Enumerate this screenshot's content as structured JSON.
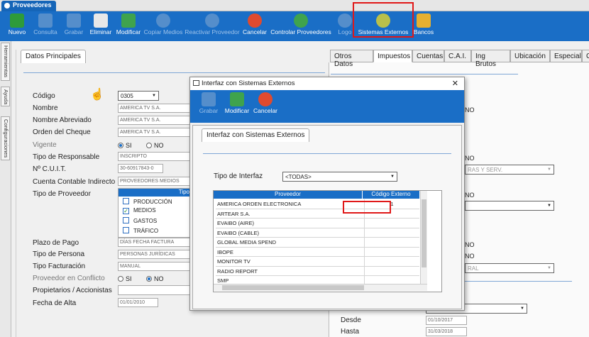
{
  "app": {
    "tab_label": "Proveedores"
  },
  "toolbar": [
    {
      "label": "Nuevo",
      "color": "#2e9b3a",
      "enabled": true
    },
    {
      "label": "Consulta",
      "color": "#9db5d0",
      "enabled": false
    },
    {
      "label": "Grabar",
      "color": "#9db5d0",
      "enabled": false
    },
    {
      "label": "Eliminar",
      "color": "#e8e8e8",
      "enabled": true
    },
    {
      "label": "Modificar",
      "color": "#3fa34d",
      "enabled": true
    },
    {
      "label": "Copiar Medios",
      "color": "#9db5d0",
      "enabled": false
    },
    {
      "label": "Reactivar Proveedor",
      "color": "#9db5d0",
      "enabled": false
    },
    {
      "label": "Cancelar",
      "color": "#e04a2f",
      "enabled": true
    },
    {
      "label": "Controlar Proveedores",
      "color": "#3fa34d",
      "enabled": true
    },
    {
      "label": "Logo",
      "color": "#9db5d0",
      "enabled": false
    },
    {
      "label": "Sistemas Externos",
      "color": "#b9c04a",
      "enabled": true
    },
    {
      "label": "Bancos",
      "color": "#e6b030",
      "enabled": true
    }
  ],
  "sidebar": [
    "Herramientas",
    "Ayuda",
    "Configuraciones"
  ],
  "left_panel": {
    "tab": "Datos Principales",
    "codigo_label": "Código",
    "codigo_value": "0305",
    "nombre_label": "Nombre",
    "nombre_value": "AMERICA TV S.A.",
    "nombre_abrev_label": "Nombre Abreviado",
    "nombre_abrev_value": "AMERICA TV S.A.",
    "orden_cheque_label": "Orden del Cheque",
    "orden_cheque_value": "AMERICA TV S.A.",
    "vigente_label": "Vigente",
    "si": "SI",
    "no": "NO",
    "tipo_resp_label": "Tipo de Responsable",
    "tipo_resp_value": "INSCRIPTO",
    "cuit_label": "Nº C.U.I.T.",
    "cuit_value": "30-60917843-0",
    "cuenta_label": "Cuenta Contable Indirecto",
    "cuenta_value": "PROVEEDORES MEDIOS",
    "tipo_prov_label": "Tipo de Proveedor",
    "tipo_col": "Tipo",
    "tipos": [
      {
        "label": "PRODUCCIÓN",
        "checked": false
      },
      {
        "label": "MEDIOS",
        "checked": true
      },
      {
        "label": "GASTOS",
        "checked": false
      },
      {
        "label": "TRÁFICO",
        "checked": false
      }
    ],
    "plazo_label": "Plazo de Pago",
    "plazo_value": "DÍAS FECHA FACTURA",
    "tipo_persona_label": "Tipo de Persona",
    "tipo_persona_value": "PERSONAS JURÍDICAS",
    "tipo_fact_label": "Tipo Facturación",
    "tipo_fact_value": "MANUAL",
    "conflicto_label": "Proveedor en Conflicto",
    "propietarios_label": "Propietarios / Accionistas",
    "fecha_alta_label": "Fecha de Alta",
    "fecha_alta_value": "01/01/2010"
  },
  "right_panel": {
    "tabs": [
      "Otros Datos",
      "Impuestos",
      "Cuentas",
      "C.A.I.",
      "Ing Brutos",
      "Ubicación",
      "Especial",
      "C"
    ],
    "desde_label": "Desde",
    "desde_value": "01/10/2017",
    "hasta_label": "Hasta",
    "hasta_value": "31/03/2018",
    "frag_no1": "NO",
    "frag_no2": "NO",
    "frag_no3": "NO",
    "frag_no4": "NO",
    "frag_no5": "NO",
    "frag_serv": "RAS Y SERV.",
    "frag_ral": "RAL"
  },
  "dialog": {
    "title": "Interfaz con Sistemas Externos",
    "close": "✕",
    "toolbar": [
      {
        "label": "Grabar",
        "enabled": false
      },
      {
        "label": "Modificar",
        "enabled": true
      },
      {
        "label": "Cancelar",
        "enabled": true
      }
    ],
    "group_tab": "Interfaz con Sistemas Externos",
    "tipo_label": "Tipo de Interfaz",
    "tipo_value": "<TODAS>",
    "col_proveedor": "Proveedor",
    "col_codigo": "Código Externo",
    "rows": [
      {
        "proveedor": "AMERICA ORDEN ELECTRONICA",
        "codigo": "1"
      },
      {
        "proveedor": "ARTEAR S.A.",
        "codigo": ""
      },
      {
        "proveedor": "EVAIBO (AIRE)",
        "codigo": ""
      },
      {
        "proveedor": "EVAIBO (CABLE)",
        "codigo": ""
      },
      {
        "proveedor": "GLOBAL MEDIA SPEND",
        "codigo": ""
      },
      {
        "proveedor": "IBOPE",
        "codigo": ""
      },
      {
        "proveedor": "MONITOR TV",
        "codigo": ""
      },
      {
        "proveedor": "RADIO REPORT",
        "codigo": ""
      },
      {
        "proveedor": "SMP",
        "codigo": ""
      }
    ]
  }
}
